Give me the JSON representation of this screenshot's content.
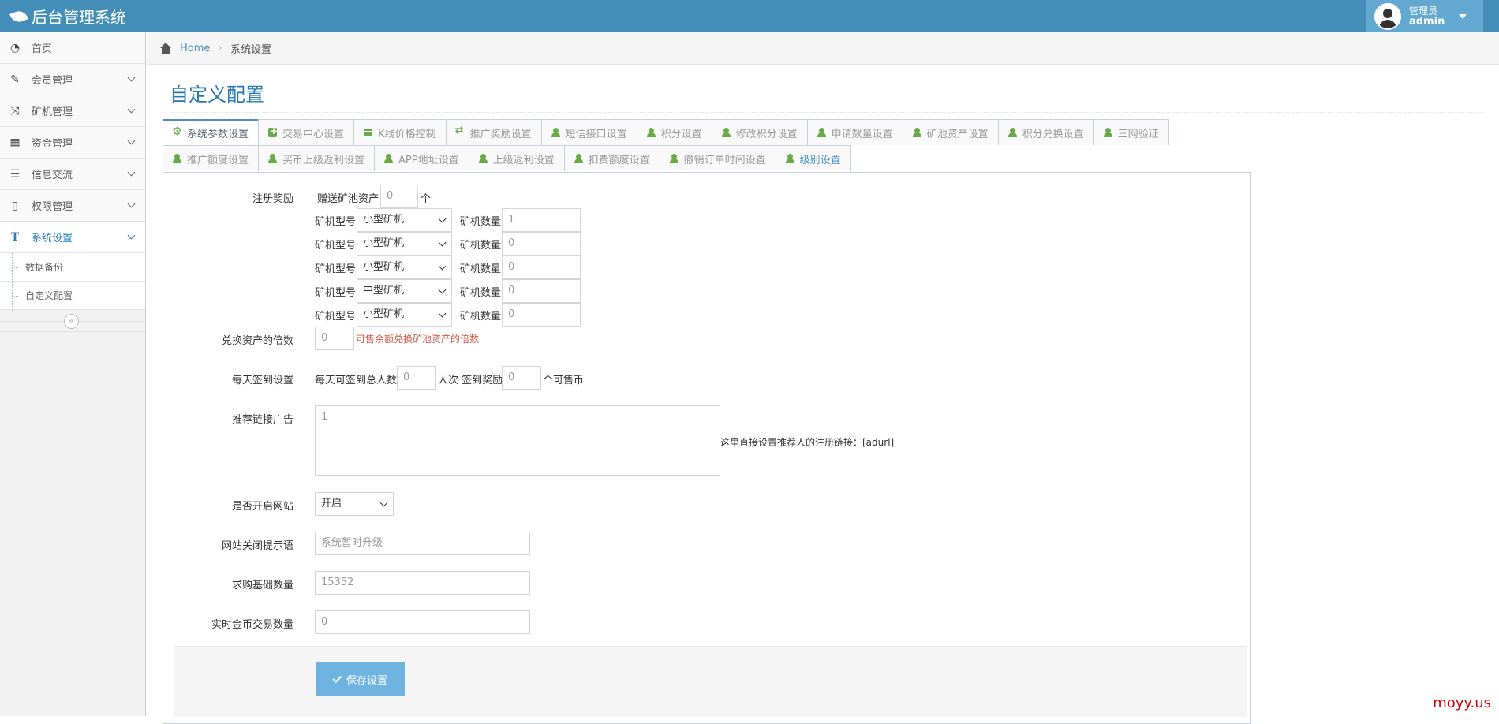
{
  "app": {
    "title": "后台管理系统"
  },
  "user": {
    "role": "管理员",
    "name": "admin"
  },
  "sidebar": {
    "items": [
      {
        "label": "首页",
        "icon": "dashboard-icon"
      },
      {
        "label": "会员管理",
        "icon": "edit-icon"
      },
      {
        "label": "矿机管理",
        "icon": "random-icon"
      },
      {
        "label": "资金管理",
        "icon": "calendar-icon"
      },
      {
        "label": "信息交流",
        "icon": "list-icon"
      },
      {
        "label": "权限管理",
        "icon": "file-icon"
      },
      {
        "label": "系统设置",
        "icon": "text-icon"
      }
    ],
    "sub_items": [
      {
        "label": "数据备份"
      },
      {
        "label": "自定义配置"
      }
    ],
    "collapse_symbol": "«"
  },
  "breadcrumb": {
    "home": "Home",
    "current": "系统设置"
  },
  "page": {
    "title": "自定义配置"
  },
  "tabs": {
    "row1": [
      "系统参数设置",
      "交易中心设置",
      "K线价格控制",
      "推广奖励设置",
      "短信接口设置",
      "积分设置",
      "修改积分设置",
      "申请数量设置",
      "矿池资产设置",
      "积分兑换设置",
      "三网验证"
    ],
    "row2": [
      "推广额度设置",
      "买币上级返利设置",
      "APP地址设置",
      "上级返利设置",
      "扣费额度设置",
      "撤销订单时间设置",
      "级别设置"
    ]
  },
  "form": {
    "reg_reward": {
      "label": "注册奖励",
      "pool_prefix": "赠送矿池资产",
      "pool_value": "0",
      "pool_suffix": "个",
      "model_label": "矿机型号",
      "count_label": "矿机数量",
      "machines": [
        {
          "model": "小型矿机",
          "count": "1"
        },
        {
          "model": "小型矿机",
          "count": "0"
        },
        {
          "model": "小型矿机",
          "count": "0"
        },
        {
          "model": "中型矿机",
          "count": "0"
        },
        {
          "model": "小型矿机",
          "count": "0"
        }
      ]
    },
    "exchange": {
      "label": "兑换资产的倍数",
      "value": "0",
      "hint": "可售余额兑换矿池资产的倍数"
    },
    "signin": {
      "label": "每天签到设置",
      "prefix": "每天可签到总人数",
      "total": "0",
      "middle": "人次 签到奖励",
      "reward": "0",
      "suffix": "个可售币"
    },
    "ad": {
      "label": "推荐链接广告",
      "value": "1",
      "hint": "这里直接设置推荐人的注册链接：[adurl]"
    },
    "site_open": {
      "label": "是否开启网站",
      "value": "开启"
    },
    "close_msg": {
      "label": "网站关闭提示语",
      "value": "系统暂时升级"
    },
    "buy_base": {
      "label": "求购基础数量",
      "value": "15352"
    },
    "realtime": {
      "label": "实时金币交易数量",
      "value": "0"
    },
    "save_label": "保存设置"
  },
  "watermark": "moyy.us"
}
